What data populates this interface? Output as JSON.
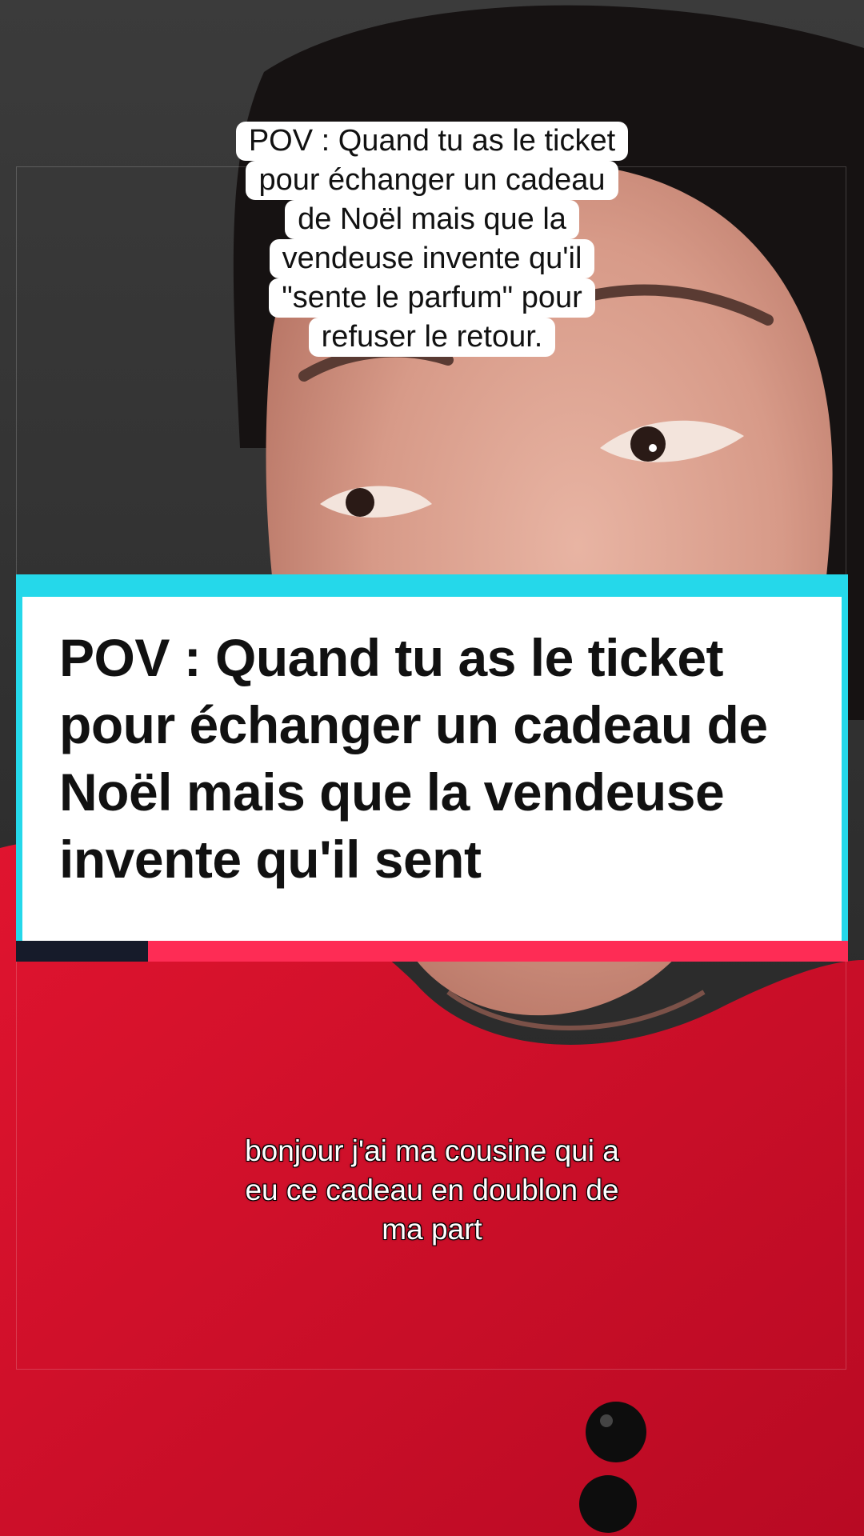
{
  "video": {
    "top_caption_lines": [
      "POV : Quand tu as le ticket",
      "pour échanger un cadeau",
      "de Noël mais que la",
      "vendeuse invente qu'il",
      "\"sente le parfum\" pour",
      "refuser le retour."
    ],
    "title_card": {
      "headline_lines": [
        "POV : Quand tu as le ticket",
        "pour échanger un cadeau de",
        "Noël mais que la vendeuse",
        "invente qu'il sent"
      ]
    },
    "subtitle_lines": [
      "bonjour j'ai ma cousine qui a",
      "eu ce cadeau en doublon de",
      "ma part"
    ]
  },
  "colors": {
    "accent_cyan": "#25d8ea",
    "accent_red": "#fe2c55",
    "accent_dark": "#161b2a",
    "shirt_red": "#d8102c",
    "background_gray": "#2b2b2b"
  }
}
